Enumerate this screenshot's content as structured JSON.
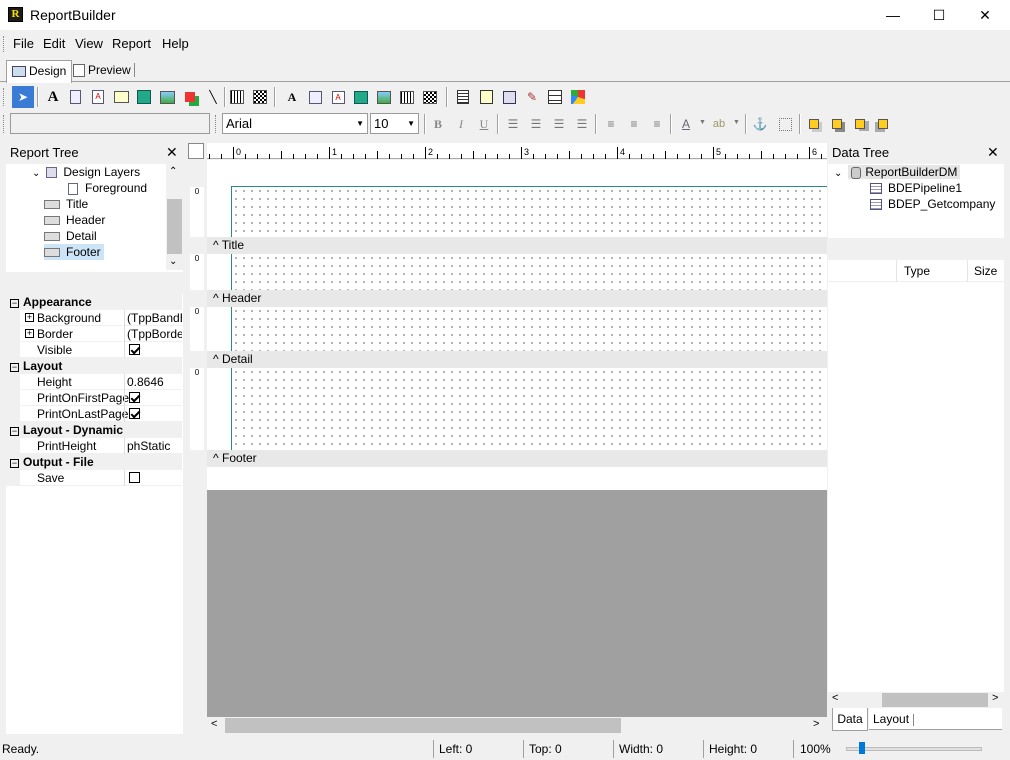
{
  "window": {
    "title": "ReportBuilder",
    "app_icon_letter": "R",
    "minimize": "—",
    "maximize": "☐",
    "close": "✕"
  },
  "menu": [
    "File",
    "Edit",
    "View",
    "Report",
    "Help"
  ],
  "tabs": [
    {
      "label": "Design",
      "active": true
    },
    {
      "label": "Preview",
      "active": false
    }
  ],
  "toolbar2": {
    "font": "Arial",
    "size": "10"
  },
  "report_tree": {
    "title": "Report Tree",
    "items": [
      {
        "label": "Design Layers",
        "depth": 1,
        "expander": "⌄"
      },
      {
        "label": "Foreground",
        "depth": 2
      },
      {
        "label": "Title",
        "depth": 1
      },
      {
        "label": "Header",
        "depth": 1
      },
      {
        "label": "Detail",
        "depth": 1
      },
      {
        "label": "Footer",
        "depth": 1,
        "selected": true
      }
    ]
  },
  "properties": [
    {
      "type": "cat",
      "label": "Appearance"
    },
    {
      "type": "prop",
      "name": "Background",
      "value": "(TppBandBa",
      "expand": true
    },
    {
      "type": "prop",
      "name": "Border",
      "value": "(TppBorder)",
      "expand": true
    },
    {
      "type": "prop",
      "name": "Visible",
      "check": true
    },
    {
      "type": "cat",
      "label": "Layout"
    },
    {
      "type": "prop",
      "name": "Height",
      "value": "0.8646"
    },
    {
      "type": "prop",
      "name": "PrintOnFirstPage",
      "check": true
    },
    {
      "type": "prop",
      "name": "PrintOnLastPage",
      "check": true
    },
    {
      "type": "cat",
      "label": "Layout - Dynamic"
    },
    {
      "type": "prop",
      "name": "PrintHeight",
      "value": "phStatic"
    },
    {
      "type": "cat",
      "label": "Output - File"
    },
    {
      "type": "prop",
      "name": "Save",
      "check": false
    }
  ],
  "ruler": {
    "marks": [
      "0",
      "1",
      "2",
      "3",
      "4",
      "5",
      "6"
    ],
    "vzero": "0"
  },
  "bands": [
    "Title",
    "Header",
    "Detail",
    "Footer"
  ],
  "band_arrow": "^",
  "data_tree": {
    "title": "Data Tree",
    "root": "ReportBuilderDM",
    "children": [
      "BDEPipeline1",
      "BDEP_Getcompany"
    ],
    "columns": {
      "type": "Type",
      "size": "Size"
    },
    "tabs": [
      "Data",
      "Layout"
    ]
  },
  "status": {
    "ready": "Ready.",
    "left": "Left: 0",
    "top": "Top: 0",
    "width": "Width: 0",
    "height": "Height: 0",
    "zoom": "100%"
  }
}
